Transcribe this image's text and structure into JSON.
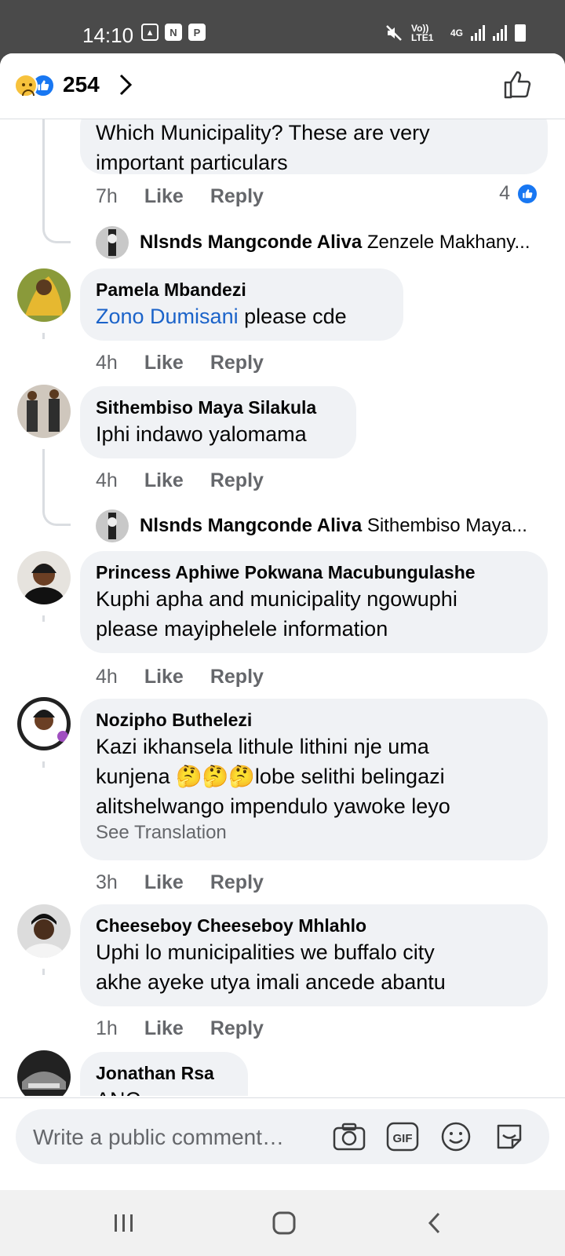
{
  "status_bar": {
    "time": "14:10",
    "icons": [
      "image-icon",
      "n-icon",
      "p-app-icon"
    ],
    "volte": "Vo)) LTE1",
    "network": "4G"
  },
  "header": {
    "reaction_icons": [
      "sad-reaction-icon",
      "like-reaction-icon"
    ],
    "reaction_count": "254"
  },
  "comments": [
    {
      "id": "c0",
      "text_lines": [
        "Which Municipality? These are very",
        "important  particulars"
      ],
      "time": "7h",
      "like_label": "Like",
      "reply_label": "Reply",
      "like_count": "4",
      "reply_preview": {
        "author": "Nlsnds Mangconde Aliva",
        "text": "Zenzele Makhany..."
      }
    },
    {
      "id": "c1",
      "author": "Pamela Mbandezi",
      "mention": "Zono Dumisani",
      "text": " please cde",
      "time": "4h",
      "like_label": "Like",
      "reply_label": "Reply"
    },
    {
      "id": "c2",
      "author": "Sithembiso Maya Silakula",
      "text": "Iphi indawo yalomama",
      "time": "4h",
      "like_label": "Like",
      "reply_label": "Reply",
      "reply_preview": {
        "author": "Nlsnds Mangconde Aliva",
        "text": "Sithembiso Maya..."
      }
    },
    {
      "id": "c3",
      "author": "Princess Aphiwe Pokwana Macubungulashe",
      "text_lines": [
        "Kuphi apha and municipality ngowuphi",
        "please mayiphelele information"
      ],
      "time": "4h",
      "like_label": "Like",
      "reply_label": "Reply"
    },
    {
      "id": "c4",
      "author": "Nozipho Buthelezi",
      "text_lines": [
        "Kazi ikhansela lithule lithini nje uma",
        "kunjena 🤔🤔🤔lobe selithi belingazi",
        "alitshelwango impendulo yawoke leyo"
      ],
      "see_translation": "See Translation",
      "time": "3h",
      "like_label": "Like",
      "reply_label": "Reply"
    },
    {
      "id": "c5",
      "author": "Cheeseboy Cheeseboy Mhlahlo",
      "text_lines": [
        "Uphi lo municipalities we buffalo city",
        "akhe ayeke utya imali ancede abantu"
      ],
      "time": "1h",
      "like_label": "Like",
      "reply_label": "Reply"
    },
    {
      "id": "c6",
      "author": "Jonathan Rsa",
      "text": "ANC ..."
    }
  ],
  "composer": {
    "placeholder": "Write a public comment…",
    "tools": [
      "camera-icon",
      "gif-icon",
      "emoji-icon",
      "sticker-icon"
    ]
  },
  "colors": {
    "accent": "#1877f2",
    "mention": "#1b63c9",
    "bubble": "#f0f2f5",
    "muted": "#65676b"
  }
}
